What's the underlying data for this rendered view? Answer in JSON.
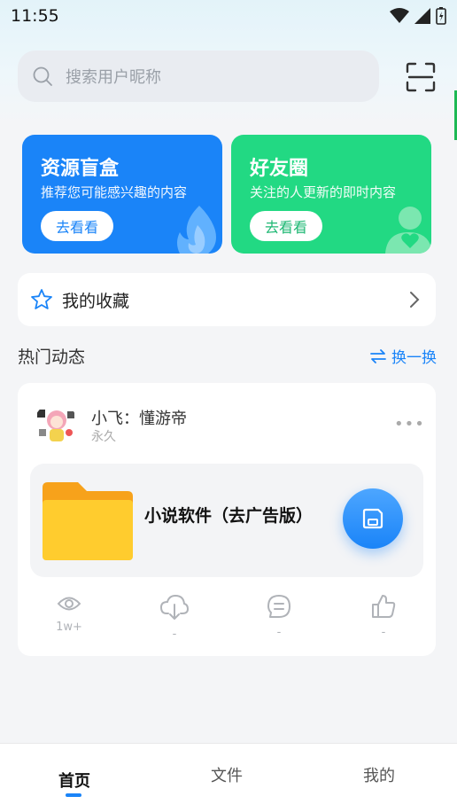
{
  "status_bar": {
    "time": "11:55"
  },
  "search": {
    "placeholder": "搜索用户昵称"
  },
  "cards": [
    {
      "title": "资源盲盒",
      "subtitle": "推荐您可能感兴趣的内容",
      "button": "去看看",
      "color": "#1a84f8"
    },
    {
      "title": "好友圈",
      "subtitle": "关注的人更新的即时内容",
      "button": "去看看",
      "color": "#22d983"
    }
  ],
  "favorites": {
    "label": "我的收藏"
  },
  "section": {
    "title": "热门动态",
    "switch_label": "换一换"
  },
  "post": {
    "user": "小飞：懂游帝",
    "sub": "永久",
    "file_name": "小说软件（去广告版）",
    "stats": {
      "views": "1w+",
      "downloads": "-",
      "comments": "-",
      "likes": "-"
    }
  },
  "tabs": [
    {
      "label": "首页",
      "active": true
    },
    {
      "label": "文件",
      "active": false
    },
    {
      "label": "我的",
      "active": false
    }
  ],
  "accent_color": "#1a84f8"
}
